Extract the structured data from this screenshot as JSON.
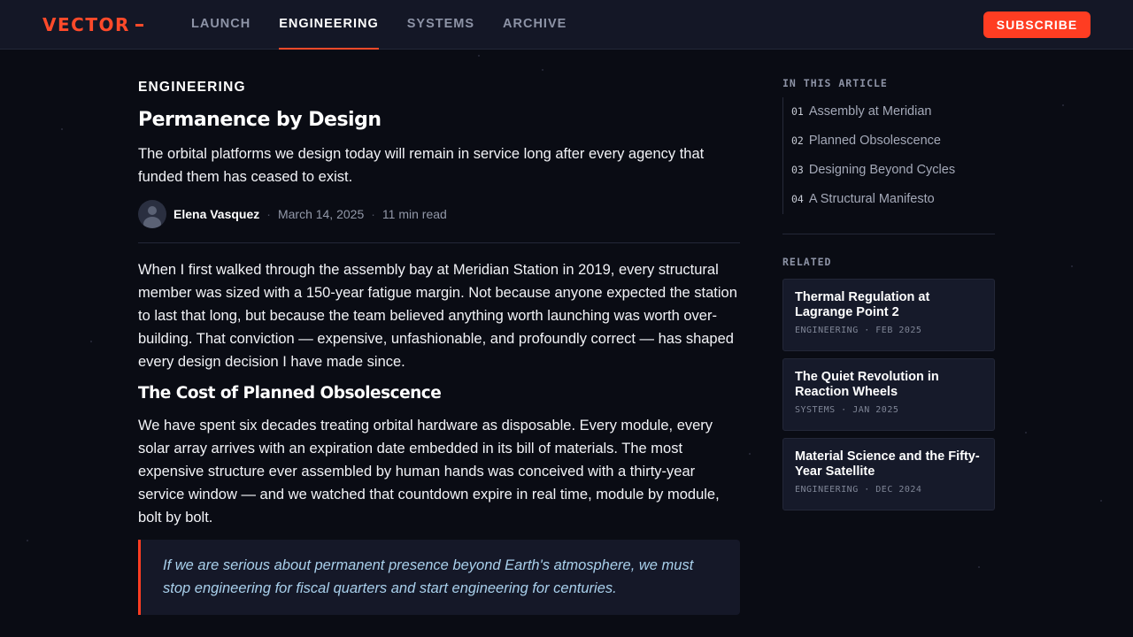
{
  "header": {
    "logo": "VECTOR",
    "nav": [
      {
        "label": "LAUNCH",
        "active": false
      },
      {
        "label": "ENGINEERING",
        "active": true
      },
      {
        "label": "SYSTEMS",
        "active": false
      },
      {
        "label": "ARCHIVE",
        "active": false
      }
    ],
    "subscribe_label": "SUBSCRIBE"
  },
  "article": {
    "category": "ENGINEERING",
    "title": "Permanence by Design",
    "lede": "The orbital platforms we design today will remain in service long after every agency that funded them has ceased to exist.",
    "author": "Elena Vasquez",
    "date": "March 14, 2025",
    "read_time": "11 min read",
    "paragraph_1": "When I first walked through the assembly bay at Meridian Station in 2019, every structural member was sized with a 150-year fatigue margin. Not because anyone expected the station to last that long, but because the team believed anything worth launching was worth over-building. That conviction — expensive, unfashionable, and profoundly correct — has shaped every design decision I have made since.",
    "subheading": "The Cost of Planned Obsolescence",
    "paragraph_2": "We have spent six decades treating orbital hardware as disposable. Every module, every solar array arrives with an expiration date embedded in its bill of materials. The most expensive structure ever assembled by human hands was conceived with a thirty-year service window — and we watched that countdown expire in real time, module by module, bolt by bolt.",
    "quote": "If we are serious about permanent presence beyond Earth's atmosphere, we must stop engineering for fiscal quarters and start engineering for centuries."
  },
  "sidebar": {
    "toc_heading": "IN THIS ARTICLE",
    "toc": [
      {
        "num": "01",
        "label": "Assembly at Meridian"
      },
      {
        "num": "02",
        "label": "Planned Obsolescence"
      },
      {
        "num": "03",
        "label": "Designing Beyond Cycles"
      },
      {
        "num": "04",
        "label": "A Structural Manifesto"
      }
    ],
    "related_heading": "RELATED",
    "related": [
      {
        "title": "Thermal Regulation at Lagrange Point 2",
        "meta": "ENGINEERING · FEB 2025"
      },
      {
        "title": "The Quiet Revolution in Reaction Wheels",
        "meta": "SYSTEMS · JAN 2025"
      },
      {
        "title": "Material Science and the Fifty-Year Satellite",
        "meta": "ENGINEERING · DEC 2024"
      }
    ]
  },
  "colors": {
    "accent": "#ff3d22",
    "background": "#0a0c14",
    "quote_text": "#a9d0ec"
  }
}
